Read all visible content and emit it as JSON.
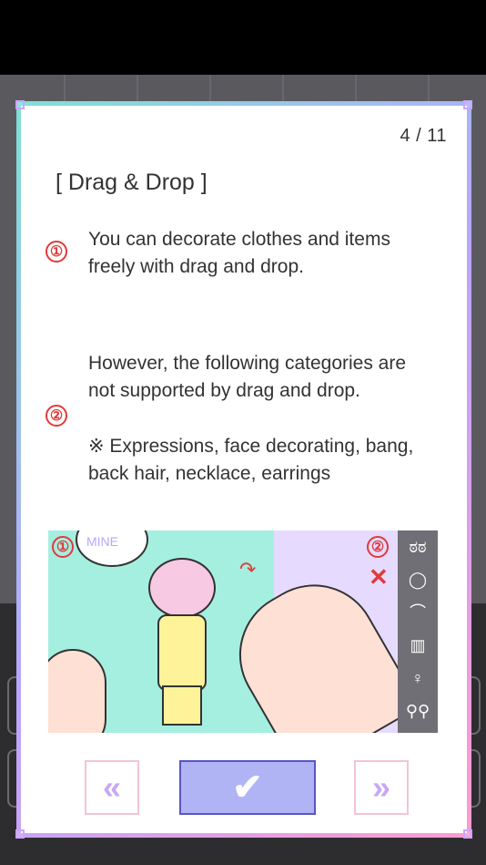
{
  "dialog": {
    "page_counter": "4 / 11",
    "title": "[ Drag & Drop ]",
    "items": [
      {
        "badge": "①",
        "text_line1": "You can decorate clothes and items",
        "text_line2": "freely with drag and drop."
      },
      {
        "badge": "②",
        "text_line1": "However, the following categories are",
        "text_line2": "not supported by drag and drop.",
        "note_line1": "※ Expressions, face decorating, bang,",
        "note_line2": "back hair, necklace, earrings"
      }
    ],
    "illustration": {
      "badge1": "①",
      "badge2": "②",
      "x_mark": "✕",
      "bubble_text": "MINE",
      "sidebar_icons": [
        "ಠಠ",
        "◯",
        "⌒",
        "▥",
        "♀",
        "⚲⚲"
      ]
    },
    "buttons": {
      "prev": "«",
      "ok": "✔",
      "next": "»"
    }
  },
  "colors": {
    "badge": "#e03a3a",
    "ok_button": "#b0b4f4",
    "nav_button_border": "#f3c4d6"
  }
}
